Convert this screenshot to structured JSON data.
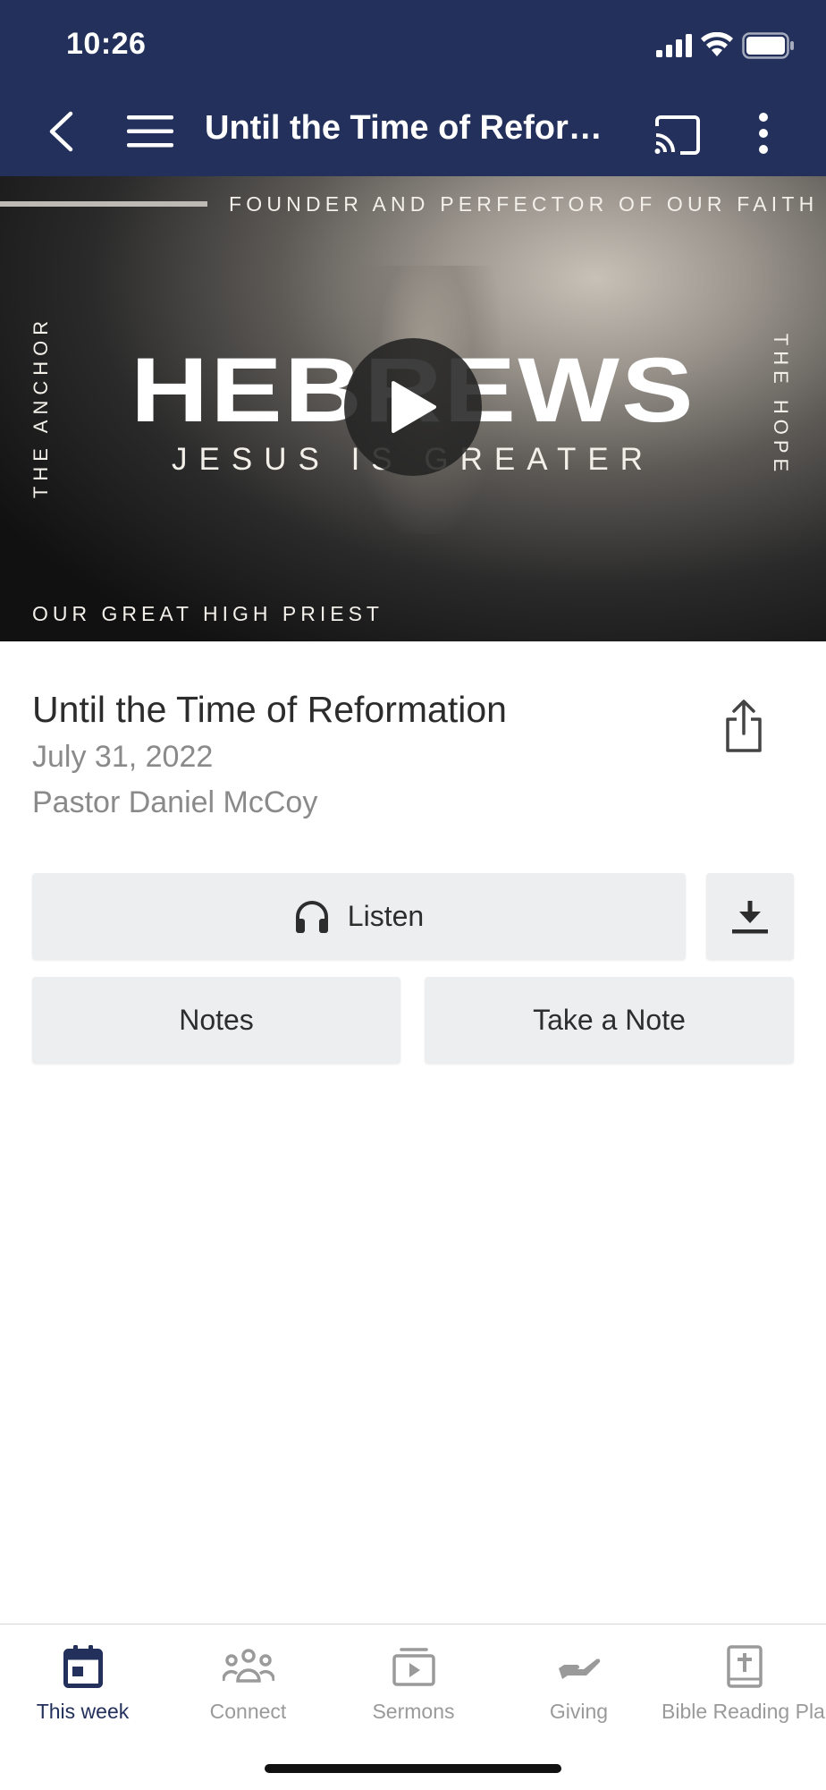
{
  "status_bar": {
    "time": "10:26"
  },
  "nav": {
    "title": "Until the Time of Reformation",
    "back_icon": "chevron-left-icon",
    "menu_icon": "hamburger-icon",
    "cast_icon": "cast-icon",
    "more_icon": "more-vertical-icon"
  },
  "hero": {
    "top_text": "FOUNDER AND PERFECTOR OF OUR FAITH",
    "left_text": "THE ANCHOR",
    "right_text": "THE HOPE",
    "title": "HEBREWS",
    "subtitle": "JESUS IS GREATER",
    "bottom_text": "OUR GREAT HIGH PRIEST",
    "play_icon": "play-icon"
  },
  "sermon": {
    "title": "Until the Time of Reformation",
    "date": "July 31, 2022",
    "speaker": "Pastor Daniel McCoy"
  },
  "actions": {
    "listen_label": "Listen",
    "notes_label": "Notes",
    "take_note_label": "Take a Note"
  },
  "tabs": [
    {
      "label": "This week",
      "icon": "calendar-icon",
      "active": true
    },
    {
      "label": "Connect",
      "icon": "people-icon",
      "active": false
    },
    {
      "label": "Sermons",
      "icon": "video-icon",
      "active": false
    },
    {
      "label": "Giving",
      "icon": "hand-icon",
      "active": false
    },
    {
      "label": "Bible Reading Plan",
      "icon": "bible-icon",
      "active": false
    }
  ],
  "colors": {
    "header": "#22305b",
    "active_tab": "#22305b",
    "inactive_tab": "#9a9a9a",
    "button_bg": "#eceef0"
  }
}
